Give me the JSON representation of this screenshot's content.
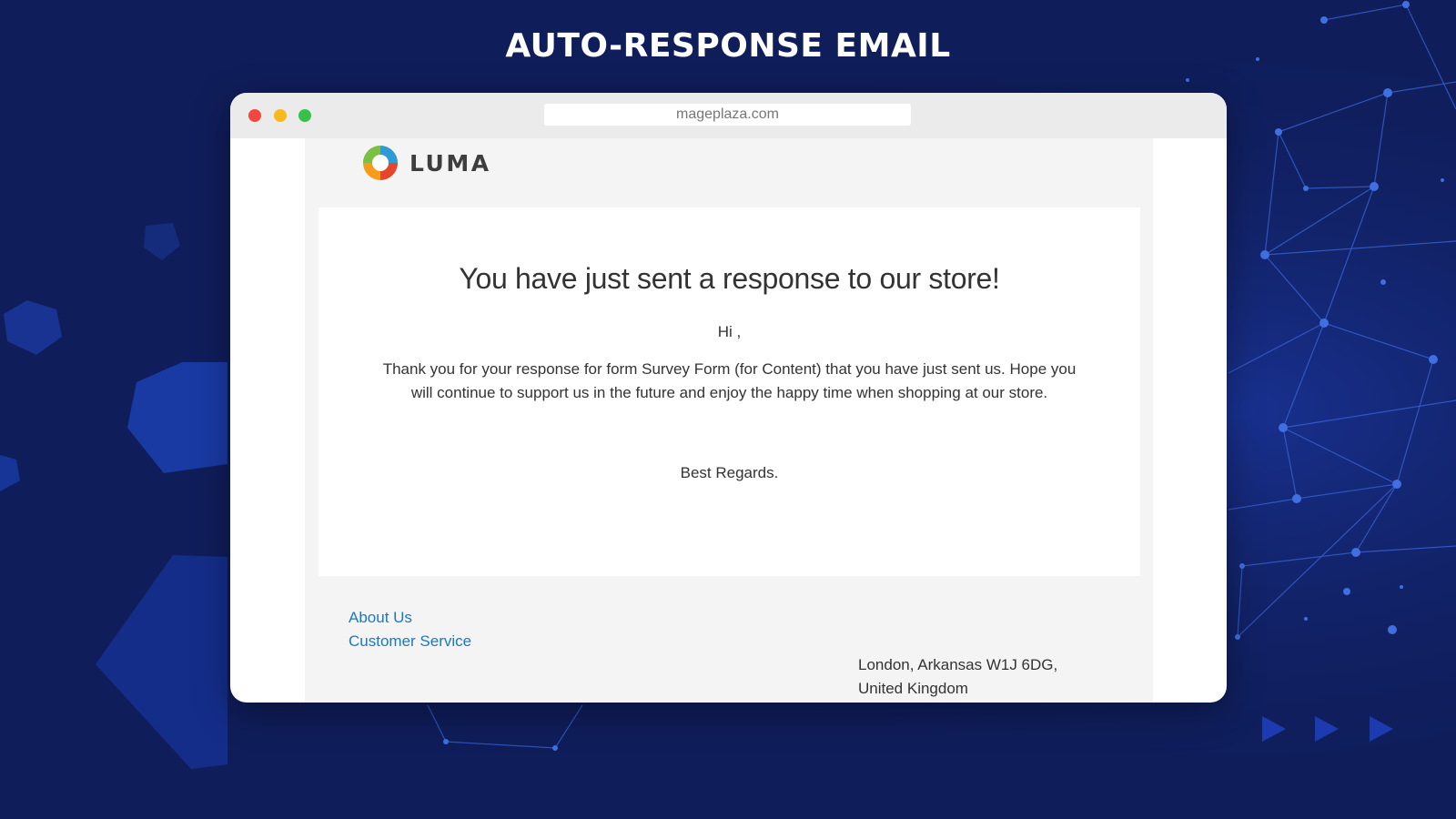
{
  "banner": {
    "title": "AUTO-RESPONSE EMAIL"
  },
  "browser": {
    "url": "mageplaza.com"
  },
  "email": {
    "brand": "LUMA",
    "headline": "You have just sent a response to our store!",
    "greeting": "Hi ,",
    "message": "Thank you for your response for form Survey Form (for Content) that you have just sent us. Hope you will continue to support us in the future and enjoy the happy time when shopping at our store.",
    "signoff": "Best Regards.",
    "footer": {
      "links": [
        "About Us",
        "Customer Service"
      ],
      "address_line1": "London, Arkansas W1J 6DG,",
      "address_line2": "United Kingdom"
    }
  },
  "colors": {
    "background": "#0f1d5a",
    "link": "#1979c3",
    "traffic_red": "#f2473f",
    "traffic_yellow": "#f8b91e",
    "traffic_green": "#38c149"
  },
  "icons": [
    "luma-logo-icon",
    "play-arrow-icon"
  ]
}
